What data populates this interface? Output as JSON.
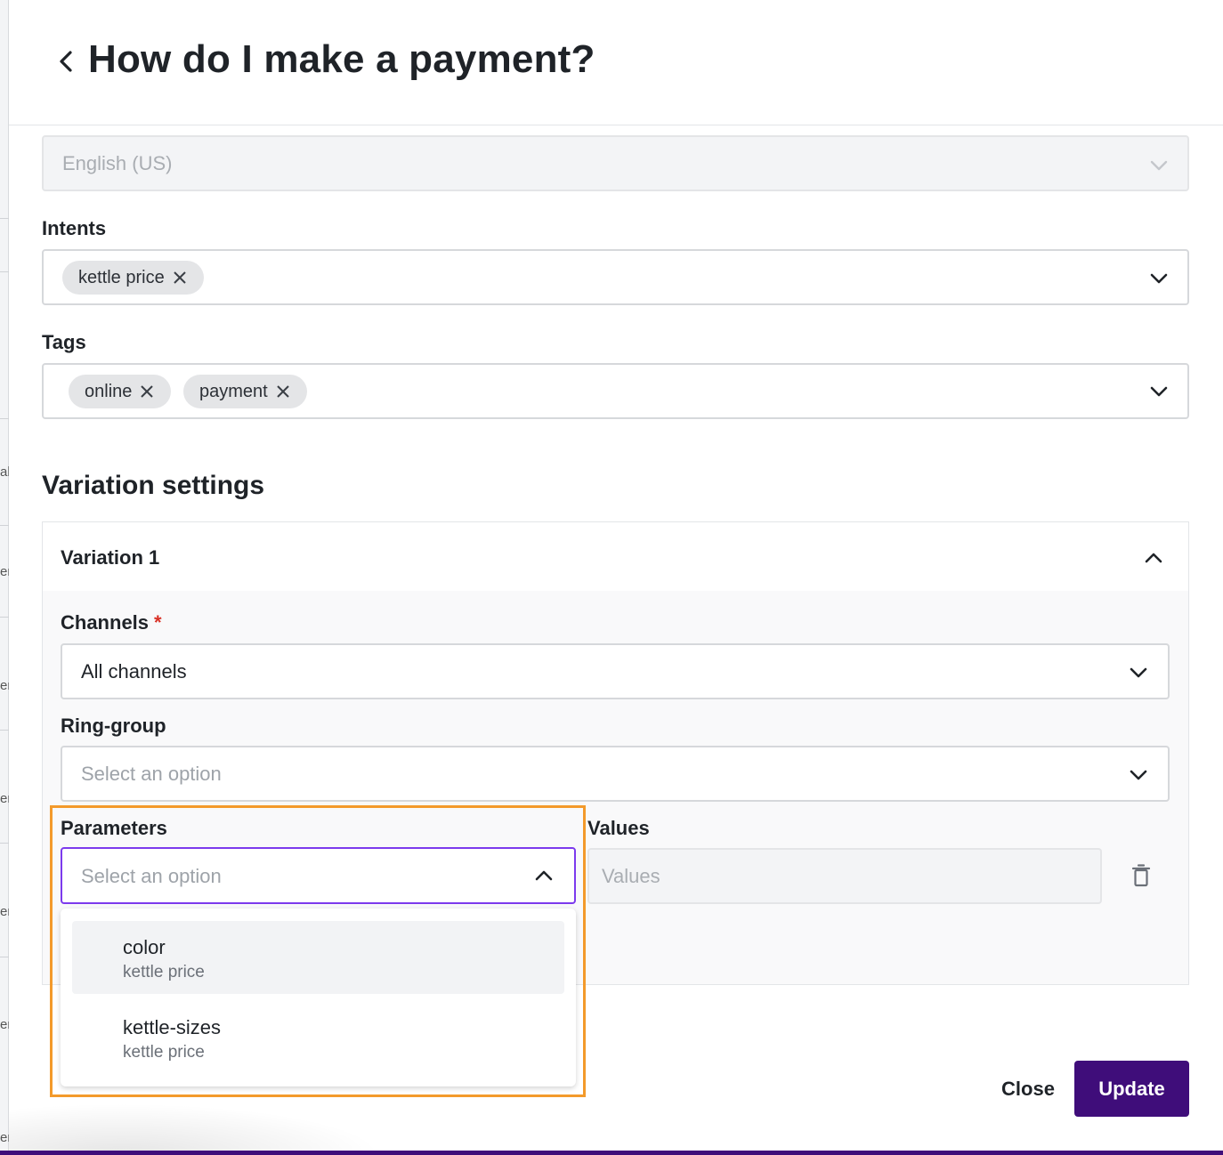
{
  "background": {
    "fragments": [
      "al",
      "er",
      "er",
      "er",
      "er",
      "er",
      "er"
    ]
  },
  "header": {
    "back_icon": "chevron-left-icon",
    "title": "How do I make a payment?"
  },
  "language": {
    "value": "English (US)",
    "disabled": true
  },
  "intents": {
    "label": "Intents",
    "chips": [
      "kettle price"
    ]
  },
  "tags": {
    "label": "Tags",
    "chips": [
      "online",
      "payment"
    ]
  },
  "variation_settings": {
    "title": "Variation settings",
    "variation": {
      "title": "Variation 1",
      "expanded": true,
      "channels": {
        "label": "Channels",
        "required_mark": "*",
        "value": "All channels"
      },
      "ring_group": {
        "label": "Ring-group",
        "placeholder": "Select an option"
      },
      "parameters": {
        "label": "Parameters",
        "placeholder": "Select an option",
        "open": true,
        "options": [
          {
            "name": "color",
            "sub": "kettle price"
          },
          {
            "name": "kettle-sizes",
            "sub": "kettle price"
          }
        ]
      },
      "values": {
        "label": "Values",
        "placeholder": "Values"
      }
    }
  },
  "footer": {
    "close_label": "Close",
    "update_label": "Update"
  },
  "colors": {
    "accent": "#3f0d7a",
    "focus": "#7c3aed",
    "highlight": "#f39a2b",
    "required": "#d93025"
  }
}
